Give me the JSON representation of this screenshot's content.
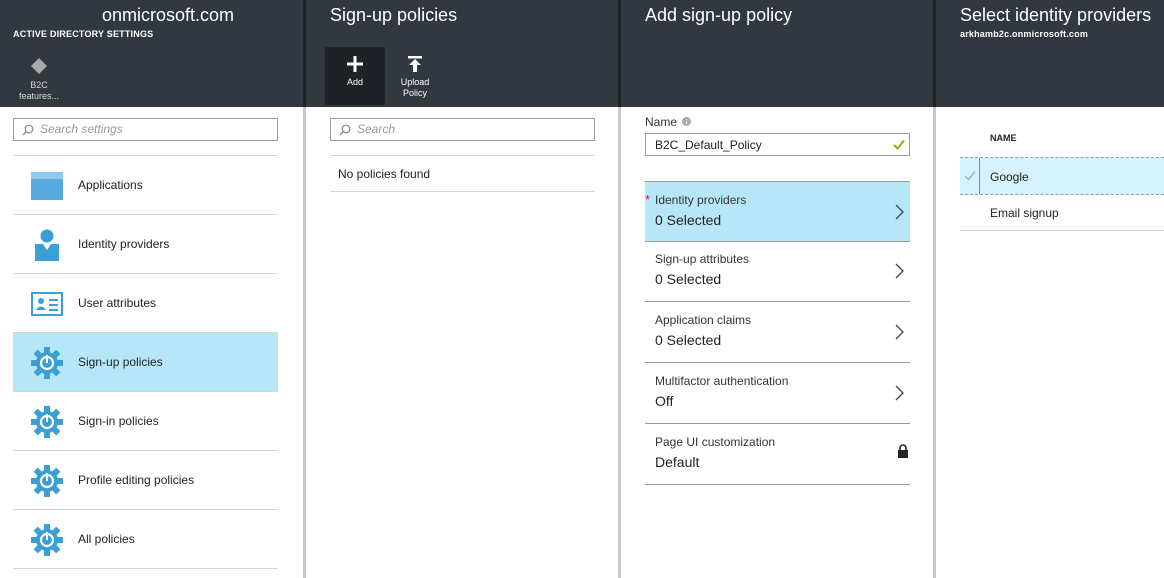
{
  "blade1": {
    "title": "onmicrosoft.com",
    "subtitle": "ACTIVE DIRECTORY SETTINGS",
    "cmd_label_1": "B2C",
    "cmd_label_2": "features...",
    "search_placeholder": "Search settings",
    "items": [
      {
        "label": "Applications",
        "icon": "applications-icon"
      },
      {
        "label": "Identity providers",
        "icon": "identity-provider-icon"
      },
      {
        "label": "User attributes",
        "icon": "user-attributes-icon"
      },
      {
        "label": "Sign-up policies",
        "icon": "gear-icon"
      },
      {
        "label": "Sign-in policies",
        "icon": "gear-icon"
      },
      {
        "label": "Profile editing policies",
        "icon": "gear-icon"
      },
      {
        "label": "All policies",
        "icon": "gear-icon"
      }
    ],
    "selected_index": 3
  },
  "blade2": {
    "title": "Sign-up policies",
    "add_label": "Add",
    "upload_label_1": "Upload",
    "upload_label_2": "Policy",
    "search_placeholder": "Search",
    "empty_text": "No policies found"
  },
  "blade3": {
    "title": "Add sign-up policy",
    "name_label": "Name",
    "name_value": "B2C_Default_Policy",
    "rows": [
      {
        "label": "Identity providers",
        "value": "0 Selected",
        "required": "*"
      },
      {
        "label": "Sign-up attributes",
        "value": "0 Selected"
      },
      {
        "label": "Application claims",
        "value": "0 Selected"
      },
      {
        "label": "Multifactor authentication",
        "value": "Off"
      },
      {
        "label": "Page UI customization",
        "value": "Default"
      }
    ]
  },
  "blade4": {
    "title": "Select identity providers",
    "subtitle": "arkhamb2c.onmicrosoft.com",
    "column_header": "NAME",
    "providers": [
      {
        "name": "Google",
        "selected": true
      },
      {
        "name": "Email signup",
        "selected": false
      }
    ]
  },
  "colors": {
    "header_bg": "#32383f",
    "selected_bg": "#b6e7f8",
    "accent": "#3a9fd6",
    "check_green": "#7fba00"
  }
}
